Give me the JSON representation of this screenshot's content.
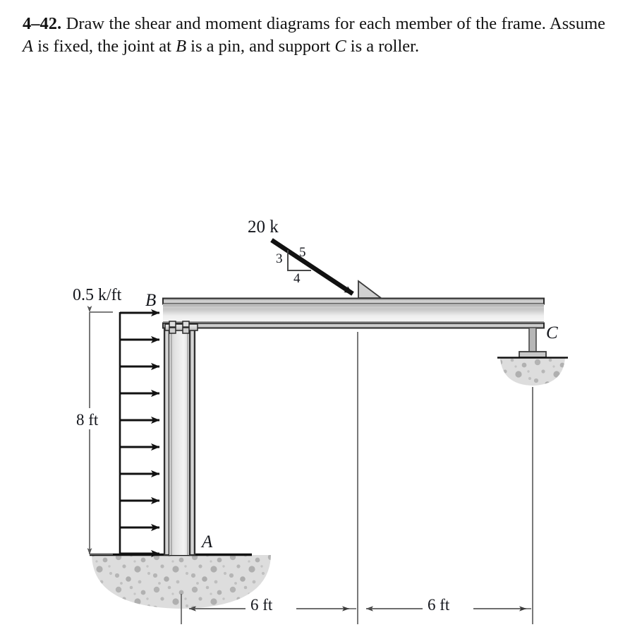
{
  "problem": {
    "number": "4–42.",
    "line1": "Draw the shear and moment diagrams for each",
    "line2_a": "member of the frame. Assume ",
    "line2_var": "A",
    "line2_b": " is fixed, the joint at ",
    "line2_var2": "B",
    "line2_c": " is a",
    "line3_a": "pin, and support ",
    "line3_var": "C",
    "line3_b": " is a roller."
  },
  "figure": {
    "point_load": {
      "magnitude": "20 k",
      "slope_rise": "3",
      "slope_hyp": "5",
      "slope_run": "4"
    },
    "distributed_load": {
      "magnitude": "0.5 k/ft",
      "arrow_count": 10
    },
    "joints": {
      "a": "A",
      "b": "B",
      "c": "C"
    },
    "dimensions": {
      "column_height": "8 ft",
      "beam_left": "6 ft",
      "beam_right": "6 ft"
    },
    "colors": {
      "steel_dark": "#3a3a3a",
      "steel_light": "#e8e8e8",
      "steel_mid": "#c4c4c4",
      "ground_fill": "#d9d9d9",
      "ground_speck": "#a8a8a8",
      "line": "#111111",
      "dimension_line": "#5a5a5a"
    }
  }
}
